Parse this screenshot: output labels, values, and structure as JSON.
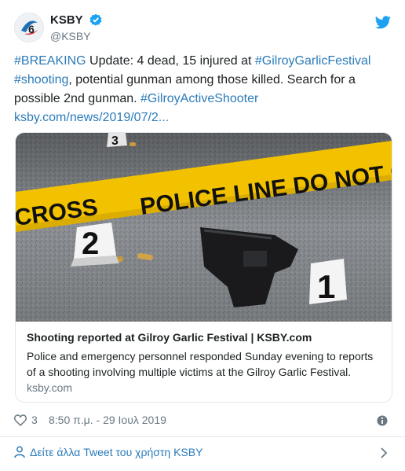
{
  "account": {
    "name": "KSBY",
    "handle": "@KSBY"
  },
  "tweet": {
    "hashtag_breaking": "#BREAKING",
    "text_1": " Update: 4 dead, 15 injured at ",
    "hashtag_festival": "#GilroyGarlicFestival",
    "hashtag_shooting": "#shooting",
    "text_2": ", potential gunman among those killed. Search for a possible 2nd gunman. ",
    "hashtag_shooter": "#GilroyActiveShooter",
    "url": "ksby.com/news/2019/07/2..."
  },
  "card": {
    "image_labels": {
      "tape": "POLICE LINE DO NOT CROSS",
      "tape_left": "CROSS",
      "marker_1": "1",
      "marker_2": "2",
      "marker_3": "3"
    },
    "title": "Shooting reported at Gilroy Garlic Festival | KSBY.com",
    "description": "Police and emergency personnel responded Sunday evening to reports of a shooting involving multiple victims at the Gilroy Garlic Festival.",
    "domain": "ksby.com"
  },
  "meta": {
    "likes": "3",
    "timestamp": "8:50 π.μ. - 29 Ιουλ 2019"
  },
  "footer": {
    "more_tweets": "Δείτε άλλα Tweet του χρήστη KSBY"
  },
  "colors": {
    "link": "#2b7bb9",
    "text": "#1c2022",
    "muted": "#697882",
    "tape": "#f2c200"
  }
}
